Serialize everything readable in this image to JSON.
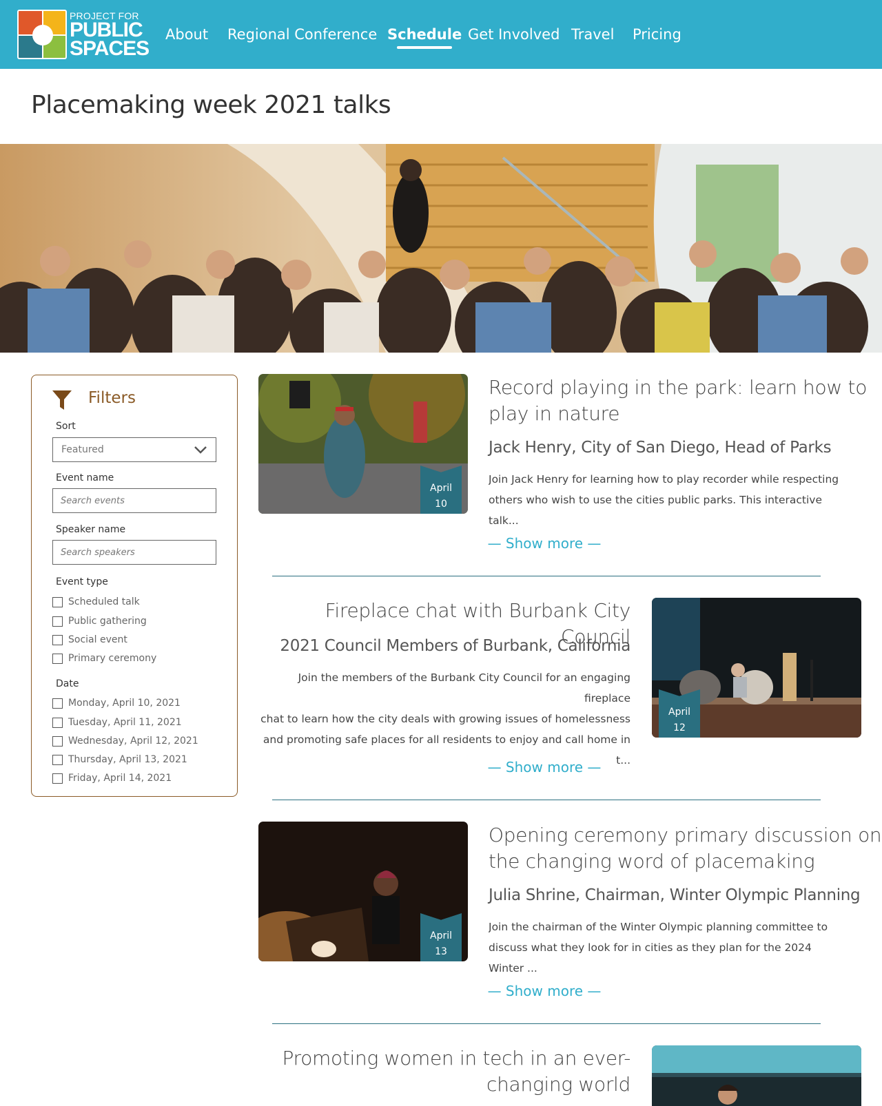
{
  "header": {
    "logo": {
      "small": "PROJECT FOR",
      "line1": "PUBLIC",
      "line2": "SPACES"
    },
    "nav": [
      {
        "label": "About",
        "active": false
      },
      {
        "label": "Regional Conference",
        "active": false
      },
      {
        "label": "Schedule",
        "active": true
      },
      {
        "label": "Get Involved",
        "active": false
      },
      {
        "label": "Travel",
        "active": false
      },
      {
        "label": "Pricing",
        "active": false
      }
    ],
    "bg_color": "#31aecb"
  },
  "page_title": "Placemaking week 2021 talks",
  "filters": {
    "title": "Filters",
    "sort_label": "Sort",
    "sort_value": "Featured",
    "event_name_label": "Event name",
    "event_name_placeholder": "Search events",
    "speaker_name_label": "Speaker name",
    "speaker_name_placeholder": "Search speakers",
    "event_type_label": "Event type",
    "event_types": [
      "Scheduled talk",
      "Public gathering",
      "Social event",
      "Primary ceremony"
    ],
    "date_label": "Date",
    "dates": [
      "Monday, April 10, 2021",
      "Tuesday, April 11, 2021",
      "Wednesday, April 12, 2021",
      "Thursday, April 13, 2021",
      "Friday, April 14, 2021"
    ],
    "accent_color": "#8a5a26"
  },
  "events": [
    {
      "title_line1": "Record playing in the park: learn how to",
      "title_line2": "play in nature",
      "speaker": "Jack Henry, City of San Diego, Head of Parks",
      "desc_line1": "Join Jack Henry for learning how to play recorder while respecting",
      "desc_line2": "others who wish to use the cities public parks. This interactive talk...",
      "month": "April",
      "day": "10",
      "show_more": "— Show more —"
    },
    {
      "title_line1": "Fireplace chat with Burbank City Council",
      "speaker": "2021 Council Members of Burbank, California",
      "desc_line1": "Join the members of the Burbank City Council for an engaging fireplace",
      "desc_line2": "chat to learn how the city deals with growing issues of homelessness",
      "desc_line3": "and promoting safe places for all residents to enjoy and call home in t...",
      "month": "April",
      "day": "12",
      "show_more": "— Show more —"
    },
    {
      "title_line1": "Opening ceremony primary discussion on",
      "title_line2": "the changing word of placemaking",
      "speaker": "Julia Shrine, Chairman, Winter Olympic Planning",
      "desc_line1": "Join the chairman of the Winter Olympic planning committee to",
      "desc_line2": "discuss what they look for in cities as they plan for the 2024 Winter ...",
      "month": "April",
      "day": "13",
      "show_more": "— Show more —"
    },
    {
      "title_line1": "Promoting women in tech in an ever-",
      "title_line2": "changing world"
    }
  ]
}
